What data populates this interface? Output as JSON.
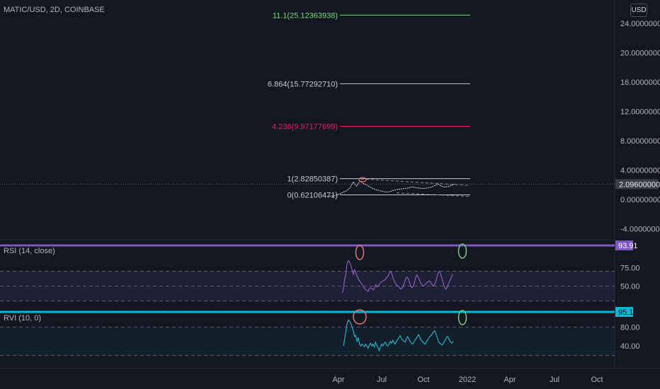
{
  "header": {
    "symbol": "MATIC/USD, 2D, COINBASE",
    "currency": "USD"
  },
  "colors": {
    "background": "#131722",
    "rsi_line": "#9c6ad9",
    "rsi_band": "#7e57c2",
    "rvi_line": "#26c6da",
    "rvi_band": "#00bcd4",
    "fib_green": "#7dd87a",
    "fib_white": "#c7c9ce",
    "fib_red": "#e91e63",
    "circle_red": "#e57373",
    "circle_green": "#81c784"
  },
  "chart_data": {
    "type": "line",
    "main": {
      "y_ticks": [
        "24.00000000",
        "20.00000000",
        "16.00000000",
        "12.00000000",
        "8.00000000",
        "4.00000000",
        "0.00000000",
        "-4.00000000"
      ],
      "y_tick_values": [
        24,
        20,
        16,
        12,
        8,
        4,
        0,
        -4
      ],
      "price_label": "2.09600000",
      "price_value": 2.096,
      "fib_levels": [
        {
          "label": "11.1(25.12363938)",
          "value": 25.12363938,
          "color": "#7dd87a"
        },
        {
          "label": "6.864(15.77292710)",
          "value": 15.7729271,
          "color": "#c7c9ce"
        },
        {
          "label": "4.236(9.97177699)",
          "value": 9.97177699,
          "color": "#e91e63"
        },
        {
          "label": "1(2.82850387)",
          "value": 2.82850387,
          "color": "#c7c9ce"
        },
        {
          "label": "0(0.62106471)",
          "value": 0.62106471,
          "color": "#c7c9ce"
        }
      ],
      "price_series": [
        0.4,
        0.45,
        0.5,
        0.6,
        0.8,
        1.0,
        1.2,
        1.6,
        2.4,
        1.8,
        2.5,
        2.2,
        2.0,
        1.7,
        1.5,
        1.3,
        1.2,
        1.1,
        1.0,
        1.05,
        1.2,
        1.3,
        1.4,
        1.45,
        1.5,
        1.6,
        1.7,
        1.6,
        1.55,
        1.5,
        1.5,
        1.6,
        1.7,
        1.9,
        2.1,
        1.8,
        1.7,
        1.75,
        1.9,
        2.1
      ]
    },
    "rsi": {
      "title": "RSI (14, close)",
      "badge": "93.91",
      "badge_value": 93.91,
      "y_ticks": [
        "75.00",
        "50.00"
      ],
      "levels": [
        70,
        50,
        30
      ],
      "ylim": [
        20,
        100
      ],
      "series": [
        41,
        45,
        58,
        66,
        80,
        84,
        82,
        78,
        72,
        66,
        72,
        68,
        63,
        60,
        57,
        55,
        52,
        50,
        47,
        45,
        44,
        43,
        47,
        48,
        46,
        45,
        48,
        52,
        49,
        50,
        53,
        55,
        56,
        57,
        58,
        60,
        62,
        64,
        68,
        70,
        66,
        60,
        56,
        53,
        51,
        50,
        48,
        46,
        47,
        50,
        55,
        60,
        62,
        60,
        55,
        50,
        48,
        50,
        55,
        62,
        65,
        62,
        58,
        54,
        52,
        50,
        51,
        53,
        55,
        56,
        57,
        55,
        52,
        50,
        52,
        56,
        62,
        68,
        70,
        66,
        60,
        54,
        49,
        46,
        48,
        52,
        56,
        60,
        64,
        66
      ]
    },
    "rvi": {
      "title": "RVI (10, 0)",
      "badge": "95.13",
      "badge_value": 95.13,
      "y_ticks": [
        "80.00",
        "40.00"
      ],
      "levels": [
        80,
        20
      ],
      "ylim": [
        0,
        100
      ],
      "series": [
        40,
        55,
        72,
        88,
        95,
        92,
        88,
        80,
        72,
        60,
        62,
        50,
        58,
        45,
        40,
        44,
        42,
        38,
        44,
        40,
        35,
        42,
        46,
        40,
        44,
        38,
        48,
        42,
        36,
        30,
        38,
        44,
        40,
        46,
        48,
        42,
        40,
        44,
        50,
        46,
        52,
        48,
        44,
        50,
        54,
        58,
        62,
        56,
        52,
        50,
        48,
        55,
        60,
        55,
        50,
        46,
        44,
        48,
        52,
        56,
        60,
        64,
        58,
        52,
        50,
        46,
        44,
        48,
        52,
        56,
        60,
        62,
        66,
        70,
        72,
        66,
        58,
        50,
        46,
        44,
        42,
        46,
        50,
        55,
        60,
        58,
        52,
        48,
        46,
        50
      ]
    },
    "x_ticks": [
      "Apr",
      "Jul",
      "Oct",
      "2022",
      "Apr",
      "Jul",
      "Oct"
    ]
  }
}
